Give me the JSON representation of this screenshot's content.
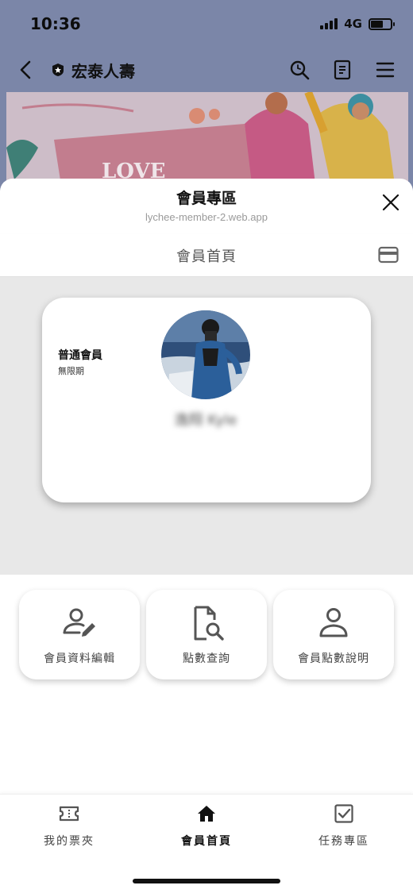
{
  "status_bar": {
    "time": "10:36",
    "network": "4G"
  },
  "line_header": {
    "account_name": "宏泰人壽"
  },
  "sheet": {
    "title": "會員專區",
    "url": "lychee-member-2.web.app"
  },
  "page": {
    "title": "會員首頁"
  },
  "member_card": {
    "level": "普通會員",
    "expiry": "無限期",
    "name": "逸翔 Kyle"
  },
  "actions": [
    {
      "label": "會員資料編輯",
      "icon": "user-edit-icon"
    },
    {
      "label": "點數查詢",
      "icon": "document-search-icon"
    },
    {
      "label": "會員點數說明",
      "icon": "user-icon"
    }
  ],
  "bottom_nav": {
    "active": "會員首頁",
    "items": [
      {
        "label": "我的票夾",
        "icon": "ticket-icon"
      },
      {
        "label": "會員首頁",
        "icon": "home-icon"
      },
      {
        "label": "任務專區",
        "icon": "checkbox-icon"
      }
    ]
  }
}
